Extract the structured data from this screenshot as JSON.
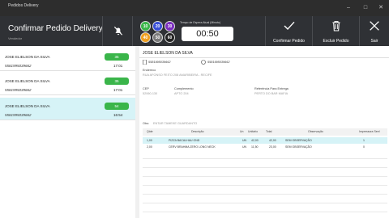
{
  "window": {
    "title": "Pedidos Delivery"
  },
  "header": {
    "title": "Confirmar Pedido Delivery",
    "subtitle": "Vendedor",
    "circles": [
      "10",
      "20",
      "30",
      "40",
      "50",
      "60"
    ],
    "circle_colors": [
      "#3ab54a",
      "#3a4fd8",
      "#7b2fbf",
      "#f0a020",
      "#7a7a7a",
      "#222222"
    ],
    "timer_label": "Tempo de Espera Atual (Minuto)",
    "timer_value": "00:50",
    "buttons": {
      "confirm": "Confirmar Pedido",
      "delete": "Excluir Pedido",
      "exit": "Sair"
    }
  },
  "orders": [
    {
      "name": "JOSE ELIELSON DA SILVA",
      "phone": "5581995039662",
      "badge": "35",
      "time": "17:01",
      "selected": false
    },
    {
      "name": "JOSE ELIELSON DA SILVA",
      "phone": "5581995039662",
      "badge": "35",
      "time": "17:01",
      "selected": false
    },
    {
      "name": "JOSE ELIELSON DA SILVA",
      "phone": "5581995039662",
      "badge": "54",
      "time": "16:54",
      "selected": true
    }
  ],
  "detail": {
    "name": "JOSE ELIELSON DA SILVA",
    "phone1": "5581995039662",
    "phone2": "5581995039662",
    "endereco_label": "Endereco",
    "endereco_value": "RUA AFONSO FEITO 208 AMARIBEIRA - RECIFE",
    "cep_label": "CEP",
    "cep_value": "52060-130",
    "complemento_label": "Complemento",
    "complemento_value": "APTO 204",
    "referencia_label": "Referência Para Entrega",
    "referencia_value": "PERTO DO BAR MAFIA",
    "obs_label": "Obs:",
    "obs_value": "ENTAR TAMEKE GUARDANTO"
  },
  "table": {
    "headers": [
      "Qtde",
      "Descrição",
      "Un",
      "Unitário",
      "Total",
      "Observação",
      "Impressora Seel"
    ],
    "rows": [
      [
        "1,00",
        "PIZZA BACALHAU GND",
        "UN",
        "42,00",
        "42,00",
        "SEM OBSERVAÇÃO",
        "1"
      ],
      [
        "2,00",
        "CERV BRAHMA ZERO LONG NECK",
        "UN",
        "11,50",
        "23,00",
        "SEM OBSERVAÇÃO",
        "0"
      ]
    ]
  }
}
